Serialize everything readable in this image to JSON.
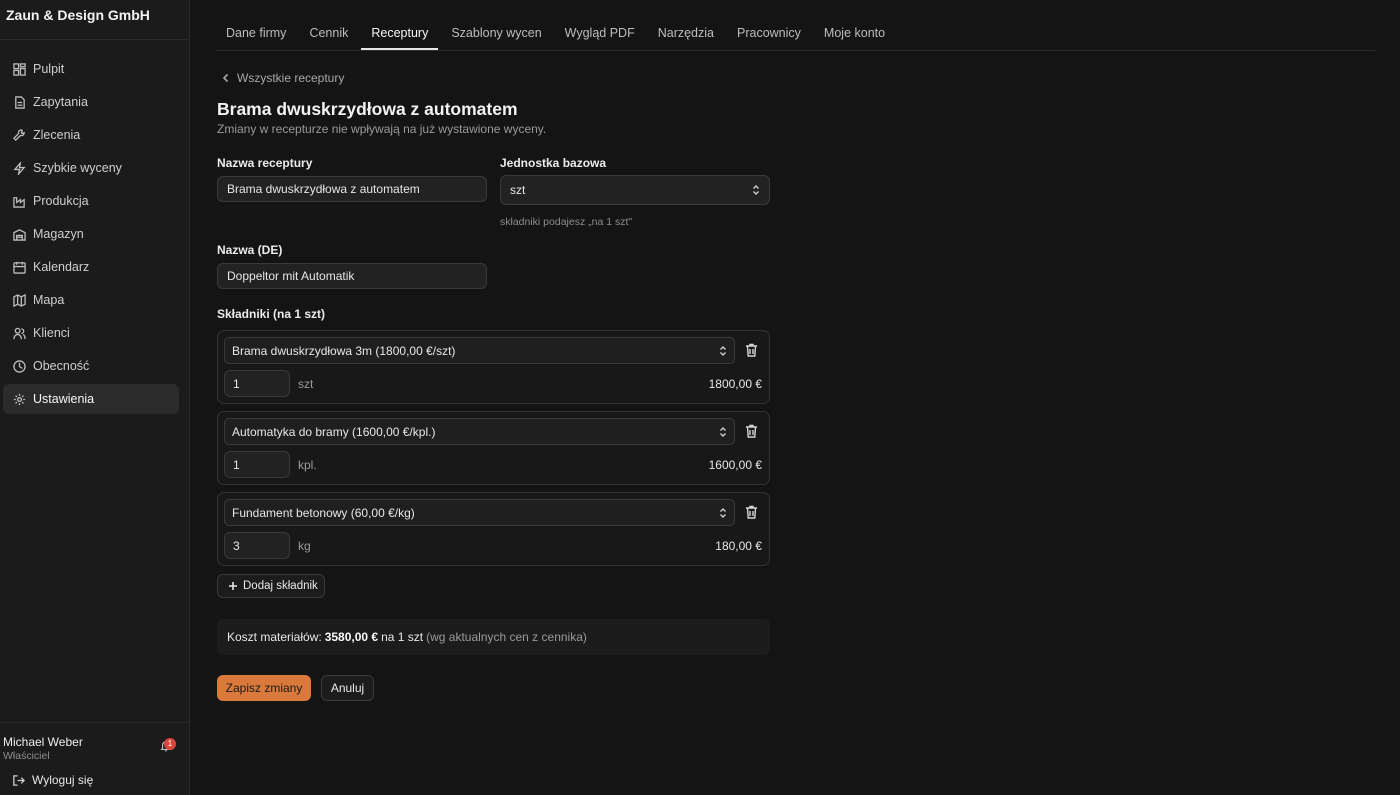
{
  "brand": "Zaun & Design GmbH",
  "sidebar": {
    "items": [
      {
        "label": "Pulpit",
        "icon": "dashboard-icon"
      },
      {
        "label": "Zapytania",
        "icon": "document-icon"
      },
      {
        "label": "Zlecenia",
        "icon": "wrench-icon"
      },
      {
        "label": "Szybkie wyceny",
        "icon": "lightning-icon"
      },
      {
        "label": "Produkcja",
        "icon": "factory-icon"
      },
      {
        "label": "Magazyn",
        "icon": "warehouse-icon"
      },
      {
        "label": "Kalendarz",
        "icon": "calendar-icon"
      },
      {
        "label": "Mapa",
        "icon": "map-icon"
      },
      {
        "label": "Klienci",
        "icon": "users-icon"
      },
      {
        "label": "Obecność",
        "icon": "clock-icon"
      },
      {
        "label": "Ustawienia",
        "icon": "gear-icon",
        "active": true
      }
    ]
  },
  "user": {
    "name": "Michael Weber",
    "role": "Właściciel",
    "notifications": "1",
    "logout": "Wyloguj się"
  },
  "tabs": [
    {
      "label": "Dane firmy"
    },
    {
      "label": "Cennik"
    },
    {
      "label": "Receptury",
      "active": true
    },
    {
      "label": "Szablony wycen"
    },
    {
      "label": "Wygląd PDF"
    },
    {
      "label": "Narzędzia"
    },
    {
      "label": "Pracownicy"
    },
    {
      "label": "Moje konto"
    }
  ],
  "page": {
    "back": "Wszystkie receptury",
    "title": "Brama dwuskrzydłowa z automatem",
    "subtitle": "Zmiany w recepturze nie wpływają na już wystawione wyceny."
  },
  "form": {
    "name_label": "Nazwa receptury",
    "name_value": "Brama dwuskrzydłowa z automatem",
    "unit_label": "Jednostka bazowa",
    "unit_value": "szt",
    "unit_hint": "składniki podajesz „na 1 szt\"",
    "name_de_label": "Nazwa (DE)",
    "name_de_value": "Doppeltor mit Automatik",
    "ingredients_label": "Składniki (na 1 szt)"
  },
  "ingredients": [
    {
      "product": "Brama dwuskrzydłowa 3m (1800,00 €/szt)",
      "qty": "1",
      "unit": "szt",
      "total": "1800,00 €"
    },
    {
      "product": "Automatyka do bramy (1600,00 €/kpl.)",
      "qty": "1",
      "unit": "kpl.",
      "total": "1600,00 €"
    },
    {
      "product": "Fundament betonowy (60,00 €/kg)",
      "qty": "3",
      "unit": "kg",
      "total": "180,00 €"
    }
  ],
  "actions": {
    "add": "Dodaj składnik",
    "save": "Zapisz zmiany",
    "cancel": "Anuluj"
  },
  "summary": {
    "prefix": "Koszt materiałów:",
    "amount": "3580,00 €",
    "per": "na 1 szt",
    "note": "(wg aktualnych cen z cennika)"
  },
  "colors": {
    "accent": "#d97a3c",
    "badge": "#d9463b",
    "background": "#141414",
    "sidebar": "#1b1b1b"
  }
}
